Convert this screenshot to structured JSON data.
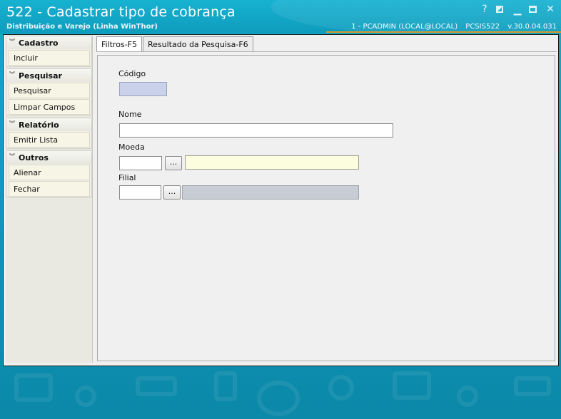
{
  "window": {
    "title": "522 - Cadastrar tipo de cobrança",
    "subtitle": "Distribuição e Varejo (Linha WinThor)",
    "user": "1 - PCADMIN (LOCAL@LOCAL)",
    "routine": "PCSIS522",
    "version": "v.30.0.04.031",
    "controls": {
      "help": "?",
      "close": "✕"
    }
  },
  "sidebar": {
    "groups": [
      {
        "title": "Cadastro",
        "items": [
          "Incluir"
        ]
      },
      {
        "title": "Pesquisar",
        "items": [
          "Pesquisar",
          "Limpar Campos"
        ]
      },
      {
        "title": "Relatório",
        "items": [
          "Emitir Lista"
        ]
      },
      {
        "title": "Outros",
        "items": [
          "Alienar",
          "Fechar"
        ]
      }
    ]
  },
  "tabs": {
    "filtros": "Filtros-F5",
    "resultado": "Resultado da Pesquisa-F6",
    "active": "filtros"
  },
  "form": {
    "codigo": {
      "label": "Código",
      "value": ""
    },
    "nome": {
      "label": "Nome",
      "value": ""
    },
    "moeda": {
      "label": "Moeda",
      "code": "",
      "button": "...",
      "description": ""
    },
    "filial": {
      "label": "Filial",
      "code": "",
      "button": "...",
      "description": ""
    }
  },
  "icons": {
    "help": "question-mark",
    "restore": "restore-window",
    "maximize": "maximize-window",
    "close": "close-x",
    "group_toggle": "double-chevron-down"
  },
  "colors": {
    "background": "#0e95b6",
    "accent_line": "#d89a2a",
    "code_field": "#c9d2ea",
    "moeda_description": "#fcfcdf",
    "filial_description": "#c8ccd4"
  }
}
